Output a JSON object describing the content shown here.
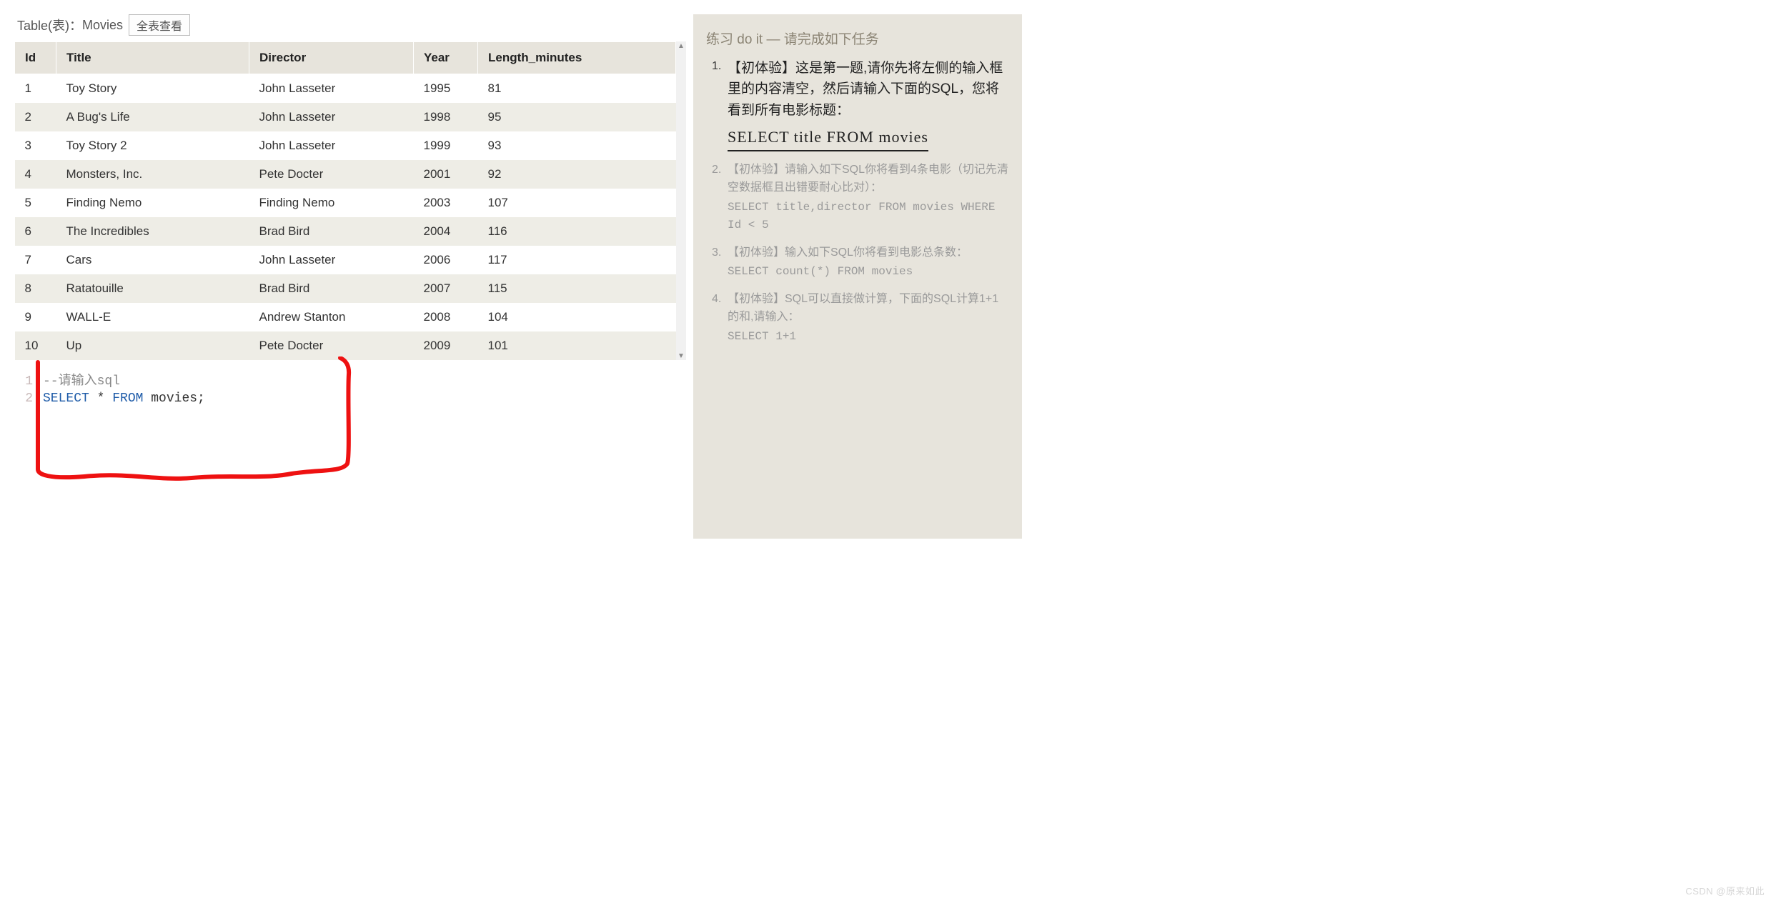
{
  "header": {
    "prefix": "Table(表)：",
    "table_name": "Movies",
    "view_all_btn": "全表查看"
  },
  "columns": [
    "Id",
    "Title",
    "Director",
    "Year",
    "Length_minutes"
  ],
  "rows": [
    {
      "Id": "1",
      "Title": "Toy Story",
      "Director": "John Lasseter",
      "Year": "1995",
      "Length_minutes": "81"
    },
    {
      "Id": "2",
      "Title": "A Bug's Life",
      "Director": "John Lasseter",
      "Year": "1998",
      "Length_minutes": "95"
    },
    {
      "Id": "3",
      "Title": "Toy Story 2",
      "Director": "John Lasseter",
      "Year": "1999",
      "Length_minutes": "93"
    },
    {
      "Id": "4",
      "Title": "Monsters, Inc.",
      "Director": "Pete Docter",
      "Year": "2001",
      "Length_minutes": "92"
    },
    {
      "Id": "5",
      "Title": "Finding Nemo",
      "Director": "Finding Nemo",
      "Year": "2003",
      "Length_minutes": "107"
    },
    {
      "Id": "6",
      "Title": "The Incredibles",
      "Director": "Brad Bird",
      "Year": "2004",
      "Length_minutes": "116"
    },
    {
      "Id": "7",
      "Title": "Cars",
      "Director": "John Lasseter",
      "Year": "2006",
      "Length_minutes": "117"
    },
    {
      "Id": "8",
      "Title": "Ratatouille",
      "Director": "Brad Bird",
      "Year": "2007",
      "Length_minutes": "115"
    },
    {
      "Id": "9",
      "Title": "WALL-E",
      "Director": "Andrew Stanton",
      "Year": "2008",
      "Length_minutes": "104"
    },
    {
      "Id": "10",
      "Title": "Up",
      "Director": "Pete Docter",
      "Year": "2009",
      "Length_minutes": "101"
    }
  ],
  "editor": {
    "line1_no": "1",
    "line2_no": "2",
    "line1_comment": "--请输入sql",
    "line2_kw1": "SELECT",
    "line2_star": " * ",
    "line2_kw2": "FROM",
    "line2_rest": " movies;"
  },
  "exercise": {
    "title": "练习 do it — 请完成如下任务",
    "items": [
      {
        "num": "1.",
        "text": "【初体验】这是第一题,请你先将左侧的输入框里的内容清空，然后请输入下面的SQL，您将看到所有电影标题：",
        "sql": "SELECT title FROM movies",
        "type": "big"
      },
      {
        "num": "2.",
        "text": "【初体验】请输入如下SQL你将看到4条电影（切记先清空数据框且出错要耐心比对）：",
        "sql": "SELECT title,director FROM movies WHERE Id < 5",
        "type": "dim"
      },
      {
        "num": "3.",
        "text": "【初体验】输入如下SQL你将看到电影总条数：",
        "sql": "SELECT count(*) FROM movies",
        "type": "dim"
      },
      {
        "num": "4.",
        "text": "【初体验】SQL可以直接做计算，下面的SQL计算1+1的和,请输入：",
        "sql": "SELECT 1+1",
        "type": "dim"
      }
    ]
  },
  "watermark": "CSDN @原来如此"
}
